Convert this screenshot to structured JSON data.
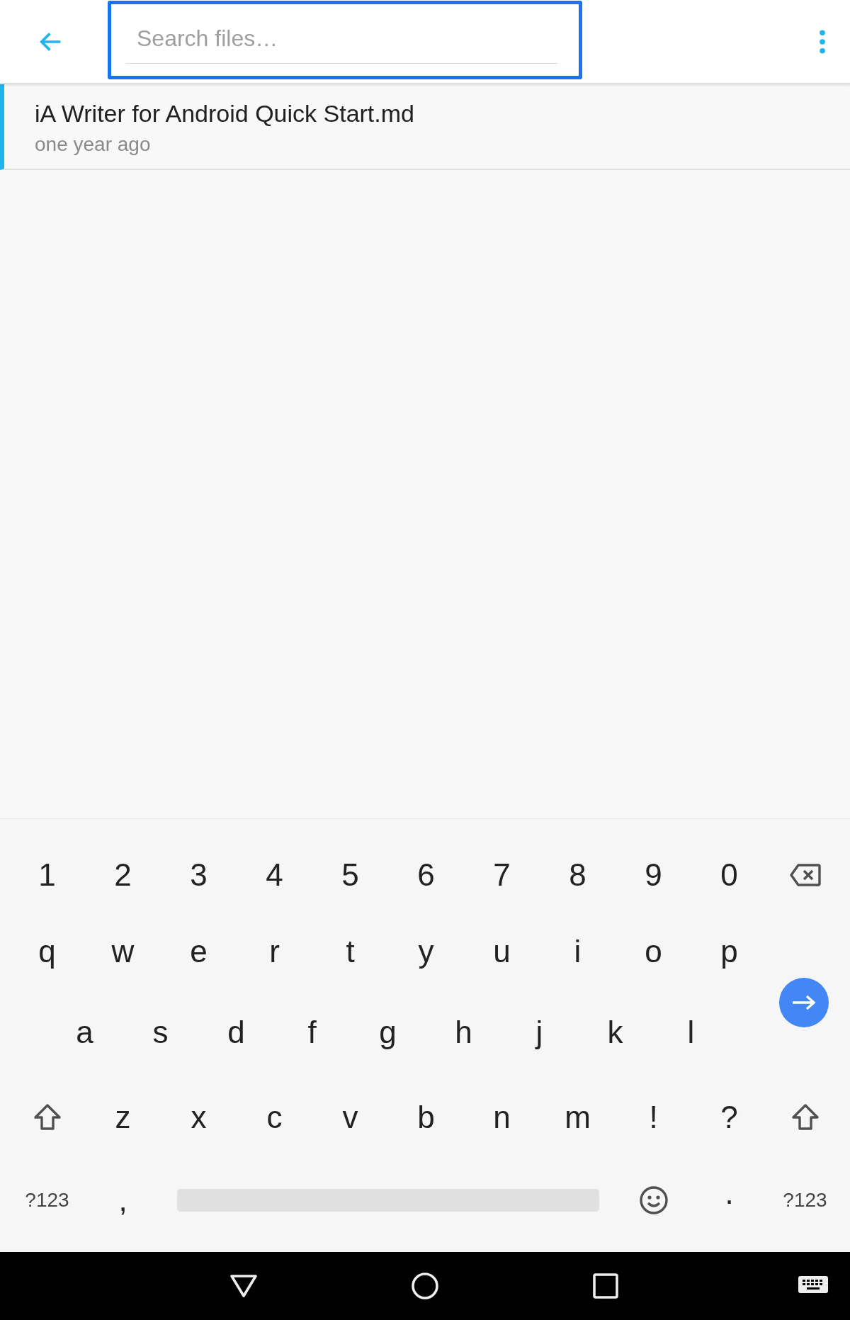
{
  "search": {
    "placeholder": "Search files…",
    "focused": true
  },
  "files": [
    {
      "name": "iA Writer for Android Quick Start.md",
      "modified": "one year ago",
      "selected": true
    }
  ],
  "keyboard": {
    "rows": [
      [
        {
          "kind": "char",
          "label": "1"
        },
        {
          "kind": "char",
          "label": "2"
        },
        {
          "kind": "char",
          "label": "3"
        },
        {
          "kind": "char",
          "label": "4"
        },
        {
          "kind": "char",
          "label": "5"
        },
        {
          "kind": "char",
          "label": "6"
        },
        {
          "kind": "char",
          "label": "7"
        },
        {
          "kind": "char",
          "label": "8"
        },
        {
          "kind": "char",
          "label": "9"
        },
        {
          "kind": "char",
          "label": "0"
        },
        {
          "kind": "backspace"
        }
      ],
      [
        {
          "kind": "char",
          "label": "q"
        },
        {
          "kind": "char",
          "label": "w"
        },
        {
          "kind": "char",
          "label": "e"
        },
        {
          "kind": "char",
          "label": "r"
        },
        {
          "kind": "char",
          "label": "t"
        },
        {
          "kind": "char",
          "label": "y"
        },
        {
          "kind": "char",
          "label": "u"
        },
        {
          "kind": "char",
          "label": "i"
        },
        {
          "kind": "char",
          "label": "o"
        },
        {
          "kind": "char",
          "label": "p"
        }
      ],
      [
        {
          "kind": "char",
          "label": "a"
        },
        {
          "kind": "char",
          "label": "s"
        },
        {
          "kind": "char",
          "label": "d"
        },
        {
          "kind": "char",
          "label": "f"
        },
        {
          "kind": "char",
          "label": "g"
        },
        {
          "kind": "char",
          "label": "h"
        },
        {
          "kind": "char",
          "label": "j"
        },
        {
          "kind": "char",
          "label": "k"
        },
        {
          "kind": "char",
          "label": "l"
        }
      ],
      [
        {
          "kind": "shift"
        },
        {
          "kind": "char",
          "label": "z"
        },
        {
          "kind": "char",
          "label": "x"
        },
        {
          "kind": "char",
          "label": "c"
        },
        {
          "kind": "char",
          "label": "v"
        },
        {
          "kind": "char",
          "label": "b"
        },
        {
          "kind": "char",
          "label": "n"
        },
        {
          "kind": "char",
          "label": "m"
        },
        {
          "kind": "char",
          "label": "!"
        },
        {
          "kind": "char",
          "label": "?"
        },
        {
          "kind": "shift"
        }
      ]
    ],
    "bottom_row": [
      {
        "kind": "mode",
        "label": "?123"
      },
      {
        "kind": "char",
        "label": ","
      },
      {
        "kind": "space"
      },
      {
        "kind": "emoji"
      },
      {
        "kind": "char",
        "label": "·"
      },
      {
        "kind": "mode",
        "label": "?123"
      }
    ]
  }
}
